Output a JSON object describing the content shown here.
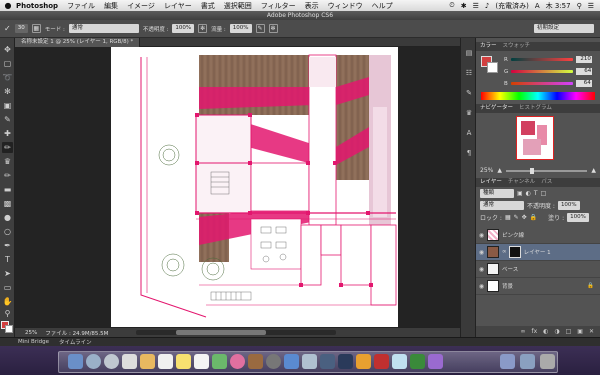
{
  "menubar": {
    "apple": "",
    "app": "Photoshop",
    "menus": [
      "ファイル",
      "編集",
      "イメージ",
      "レイヤー",
      "書式",
      "選択範囲",
      "フィルター",
      "表示",
      "ウィンドウ",
      "ヘルプ"
    ],
    "battery": "(充電済み)",
    "clock": "木 3:57"
  },
  "window": {
    "title": "Adobe Photoshop CS6"
  },
  "options": {
    "brush_size": "30",
    "mode_label": "モード :",
    "mode_value": "通常",
    "opacity_label": "不透明度 :",
    "opacity_value": "100%",
    "flow_label": "流量 :",
    "flow_value": "100%",
    "workspace": "初期設定"
  },
  "document": {
    "tab_label": "名称未設定 1 @ 25% (レイヤー 1, RGB/8) *",
    "zoom": "25%",
    "file_info": "ファイル : 24.9M/85.5M"
  },
  "bottom": {
    "mini_bridge": "Mini Bridge",
    "timeline": "タイムライン"
  },
  "color_panel": {
    "tabs": [
      "カラー",
      "スウォッチ"
    ],
    "r_label": "R",
    "g_label": "G",
    "b_label": "B",
    "r": "210",
    "g": "64",
    "b": "64",
    "foreground": "#d24040"
  },
  "navigator": {
    "tabs": [
      "ナビゲーター",
      "ヒストグラム"
    ],
    "zoom": "25%"
  },
  "layers_panel": {
    "tabs": [
      "レイヤー",
      "チャンネル",
      "パス"
    ],
    "kind": "種類",
    "blend": "通常",
    "opacity_label": "不透明度 :",
    "opacity": "100%",
    "lock_label": "ロック :",
    "fill_label": "塗り :",
    "fill": "100%",
    "layers": [
      {
        "name": "ピンク線",
        "selected": false
      },
      {
        "name": "レイヤー 1",
        "selected": true
      },
      {
        "name": "ベース",
        "selected": false
      },
      {
        "name": "背景",
        "selected": false
      }
    ]
  },
  "colors": {
    "accent_pink": "#e3166e",
    "wood": "#8a6a55"
  }
}
